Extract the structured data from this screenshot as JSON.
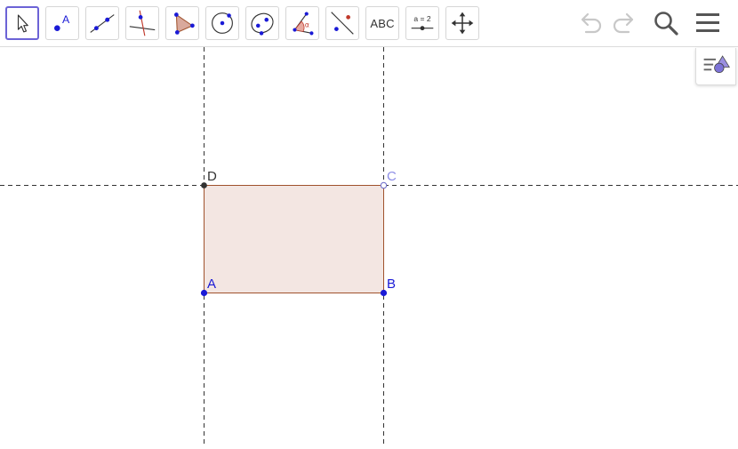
{
  "toolbar": {
    "tools": [
      {
        "id": "move",
        "label": "",
        "icon": "cursor-arrow-icon",
        "selected": true
      },
      {
        "id": "point",
        "label": "A",
        "icon": "point-icon"
      },
      {
        "id": "line",
        "label": "",
        "icon": "line-through-two-points-icon"
      },
      {
        "id": "perpendicular",
        "label": "",
        "icon": "perpendicular-line-icon"
      },
      {
        "id": "polygon",
        "label": "",
        "icon": "polygon-icon"
      },
      {
        "id": "circle",
        "label": "",
        "icon": "circle-with-center-icon"
      },
      {
        "id": "ellipse",
        "label": "",
        "icon": "ellipse-icon"
      },
      {
        "id": "angle",
        "label": "α",
        "icon": "angle-icon"
      },
      {
        "id": "reflect",
        "label": "",
        "icon": "reflect-about-line-icon"
      },
      {
        "id": "text",
        "label": "ABC",
        "icon": "text-icon"
      },
      {
        "id": "slider",
        "label": "a = 2",
        "icon": "slider-icon"
      },
      {
        "id": "move-graphics",
        "label": "",
        "icon": "move-graphics-view-icon"
      }
    ],
    "right_icons": [
      "undo-icon",
      "redo-icon",
      "search-icon",
      "menu-icon"
    ]
  },
  "style_bar": {
    "icon": "style-bar-toggle-icon"
  },
  "points": {
    "A": {
      "label": "A",
      "color": "#1a1ad6"
    },
    "B": {
      "label": "B",
      "color": "#1a1ad6"
    },
    "C": {
      "label": "C",
      "color": "#8c8ce6"
    },
    "D": {
      "label": "D",
      "color": "#333333"
    }
  },
  "polygon": {
    "vertices": [
      "A",
      "B",
      "C",
      "D"
    ],
    "fill": "#f3e6e2",
    "stroke": "#a0522d"
  },
  "colors": {
    "accent": "#6c63d6",
    "point_blue": "#1a1ad6",
    "dashed_line": "#333333"
  }
}
